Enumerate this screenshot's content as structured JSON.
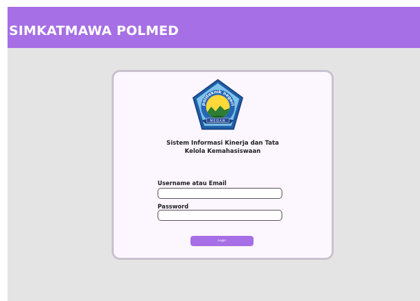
{
  "header": {
    "title": "SIMKATMAWA POLMED"
  },
  "logo": {
    "ring_text": "politeknik negeri",
    "ribbon_text": "MEDAN"
  },
  "login": {
    "title_line1": "Sistem Informasi Kinerja dan Tata",
    "title_line2": "Kelola Kemahasiswaan",
    "username_label": "Username atau Email",
    "username_value": "",
    "password_label": "Password",
    "password_value": "",
    "login_label": "Login"
  },
  "colors": {
    "accent": "#a66fe5",
    "background": "#e4e4e4",
    "card": "#fcf6fe"
  }
}
